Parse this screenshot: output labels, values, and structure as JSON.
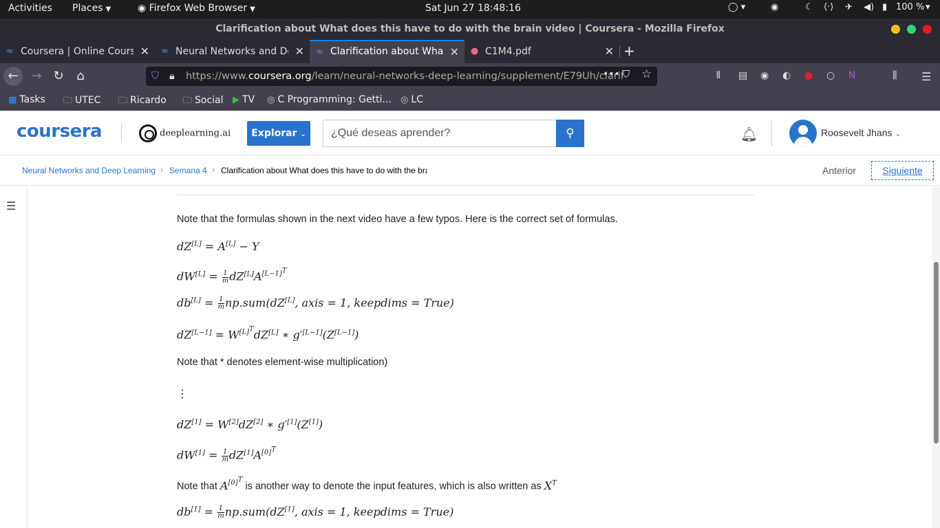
{
  "os": {
    "activities": "Activities",
    "places": "Places",
    "app": "Firefox Web Browser",
    "clock": "Sat Jun 27  18:48:16",
    "battery": "100 %"
  },
  "window": {
    "title": "Clarification about What does this have to do with the brain video | Coursera - Mozilla Firefox"
  },
  "tabs": [
    {
      "label": "Coursera | Online Course"
    },
    {
      "label": "Neural Networks and De"
    },
    {
      "label": "Clarification about What"
    },
    {
      "label": "C1M4.pdf"
    }
  ],
  "url": {
    "prefix": "https://www.",
    "domain": "coursera.org",
    "path": "/learn/neural-networks-deep-learning/supplement/E79Uh/clarif"
  },
  "bookmarks": [
    "Tasks",
    "UTEC",
    "Ricardo",
    "Social",
    "TV",
    "C Programming: Getti...",
    "LC"
  ],
  "header": {
    "logo": "coursera",
    "partner": "deeplearning.ai",
    "explore": "Explorar",
    "search_placeholder": "¿Qué deseas aprender?",
    "user": "Roosevelt Jhans"
  },
  "breadcrumb": {
    "course": "Neural Networks and Deep Learning",
    "week": "Semana 4",
    "page": "Clarification about What does this have to do with the bra",
    "prev": "Anterior",
    "next": "Siguiente"
  },
  "content": {
    "intro": "Note that the formulas shown in the next video have a few typos. Here is the correct set of formulas.",
    "note_star": "Note that * denotes element-wise multiplication)",
    "note_a0_prefix": "Note that",
    "note_a0_mid": "is another way to denote the input features, which is also written as",
    "ellipsis": "⋮"
  },
  "colors": {
    "accent": "#2a73cc",
    "firefox_dark": "#42414d",
    "tab_focus": "#0a84ff"
  }
}
